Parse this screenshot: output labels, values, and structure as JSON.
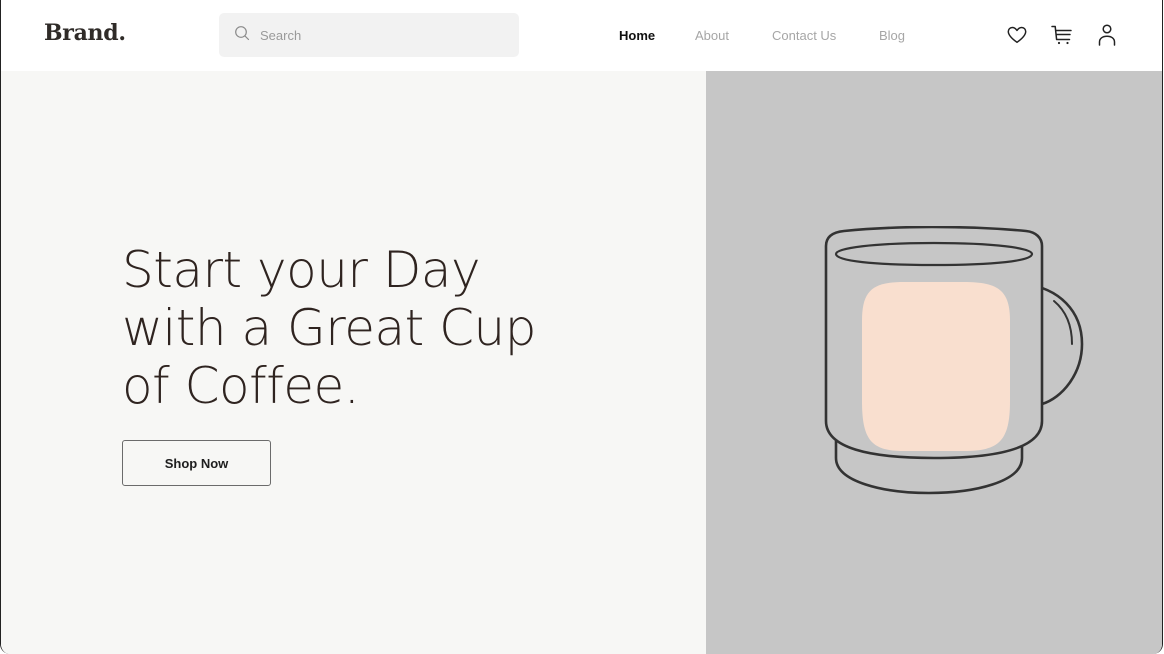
{
  "header": {
    "brand": "Brand.",
    "search": {
      "placeholder": "Search",
      "value": ""
    },
    "nav": [
      {
        "label": "Home",
        "active": true
      },
      {
        "label": "About",
        "active": false
      },
      {
        "label": "Contact Us",
        "active": false
      },
      {
        "label": "Blog",
        "active": false
      }
    ],
    "icons": [
      "heart-icon",
      "cart-icon",
      "user-icon"
    ]
  },
  "hero": {
    "title_lines": [
      "Start your Day",
      "with a Great Cup",
      "of Coffee."
    ],
    "cta_label": "Shop Now",
    "image": "coffee-mug-illustration"
  },
  "colors": {
    "hero_left_bg": "#f7f7f5",
    "hero_right_bg": "#c6c6c6",
    "coffee_fill": "#f9dfcf",
    "text_dark": "#2f2420"
  }
}
